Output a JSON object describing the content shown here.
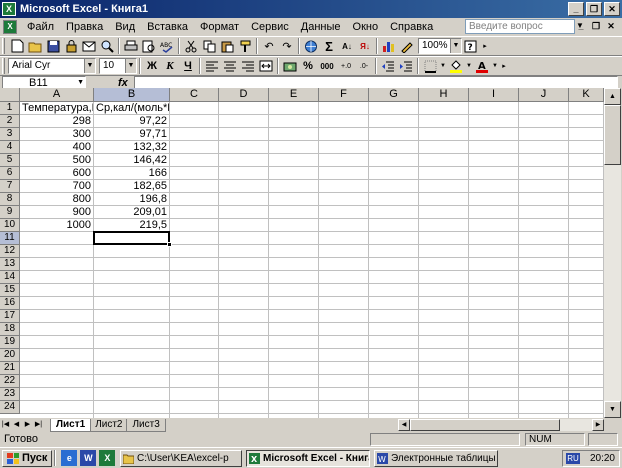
{
  "window": {
    "title": "Microsoft Excel - Книга1",
    "app_badge": "X",
    "doc_badge": "X"
  },
  "window_buttons": {
    "minimize": "_",
    "maximize": "❐",
    "close": "✕"
  },
  "doc_buttons": {
    "minimize": "_",
    "restore": "❐",
    "close": "✕"
  },
  "menu": [
    "Файл",
    "Правка",
    "Вид",
    "Вставка",
    "Формат",
    "Сервис",
    "Данные",
    "Окно",
    "Справка"
  ],
  "help_box": {
    "placeholder": "Введите вопрос"
  },
  "toolbar": {
    "zoom": "100%",
    "font_name": "Arial Cyr",
    "font_size": "10",
    "bold": "Ж",
    "italic": "К",
    "underline": "Ч",
    "autosum": "Σ",
    "percent": "%",
    "thousands": "000"
  },
  "formula_bar": {
    "name_box": "B11",
    "fx": "fx",
    "content": ""
  },
  "columns": [
    "A",
    "B",
    "C",
    "D",
    "E",
    "F",
    "G",
    "H",
    "I",
    "J",
    "K"
  ],
  "rows": [
    "1",
    "2",
    "3",
    "4",
    "5",
    "6",
    "7",
    "8",
    "9",
    "10",
    "11",
    "12",
    "13",
    "14",
    "15",
    "16",
    "17",
    "18",
    "19",
    "20",
    "21",
    "22",
    "23",
    "24"
  ],
  "cells": {
    "A1": "Температура,К",
    "B1": "Cp,кал/(моль*К)",
    "A_values": [
      "298",
      "300",
      "400",
      "500",
      "600",
      "700",
      "800",
      "900",
      "1000"
    ],
    "B_values": [
      "97,22",
      "97,71",
      "132,32",
      "146,42",
      "166",
      "182,65",
      "196,8",
      "209,01",
      "219,5"
    ]
  },
  "selected_cell": "B11",
  "sheets": [
    "Лист1",
    "Лист2",
    "Лист3"
  ],
  "active_sheet": "Лист1",
  "status": {
    "text": "Готово",
    "num": "NUM"
  },
  "taskbar": {
    "start": "Пуск",
    "quick_launch": [
      "e",
      "W",
      "X"
    ],
    "tasks": [
      {
        "label": "C:\\User\\KEA\\excel-p",
        "active": false
      },
      {
        "label": "Microsoft Excel - Книга1",
        "active": true
      },
      {
        "label": "Электронные таблицы ...",
        "active": false
      }
    ],
    "lang": "RU",
    "clock": "20:20"
  },
  "colors": {
    "title_start": "#0a246a",
    "title_end": "#3a6ea5",
    "excel_green": "#1d7a3a",
    "selected_header": "#b5bed6"
  }
}
